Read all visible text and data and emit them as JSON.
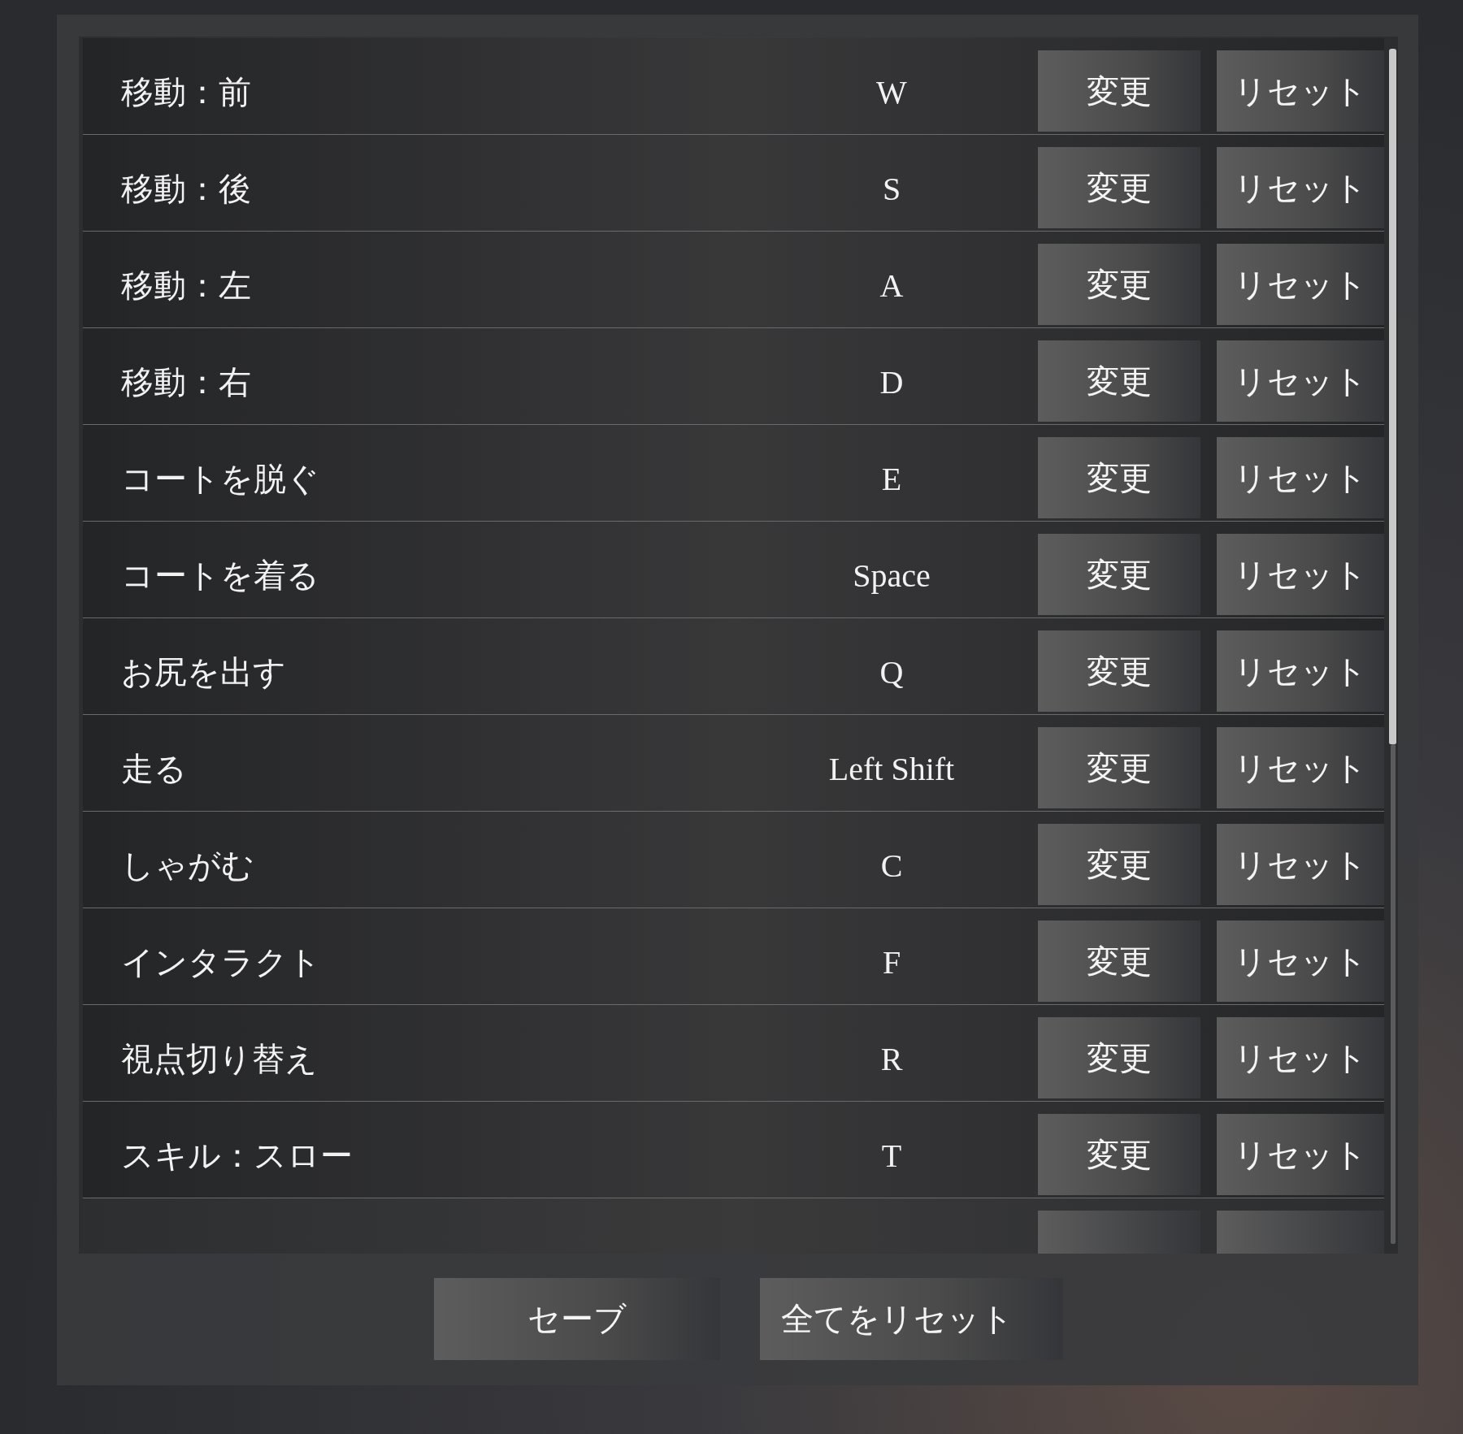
{
  "bindings": [
    {
      "action": "移動：前",
      "key": "W",
      "change": "変更",
      "reset": "リセット"
    },
    {
      "action": "移動：後",
      "key": "S",
      "change": "変更",
      "reset": "リセット"
    },
    {
      "action": "移動：左",
      "key": "A",
      "change": "変更",
      "reset": "リセット"
    },
    {
      "action": "移動：右",
      "key": "D",
      "change": "変更",
      "reset": "リセット"
    },
    {
      "action": "コートを脱ぐ",
      "key": "E",
      "change": "変更",
      "reset": "リセット"
    },
    {
      "action": "コートを着る",
      "key": "Space",
      "change": "変更",
      "reset": "リセット"
    },
    {
      "action": "お尻を出す",
      "key": "Q",
      "change": "変更",
      "reset": "リセット"
    },
    {
      "action": "走る",
      "key": "Left Shift",
      "change": "変更",
      "reset": "リセット"
    },
    {
      "action": "しゃがむ",
      "key": "C",
      "change": "変更",
      "reset": "リセット"
    },
    {
      "action": "インタラクト",
      "key": "F",
      "change": "変更",
      "reset": "リセット"
    },
    {
      "action": "視点切り替え",
      "key": "R",
      "change": "変更",
      "reset": "リセット"
    },
    {
      "action": "スキル：スロー",
      "key": "T",
      "change": "変更",
      "reset": "リセット"
    }
  ],
  "footer_buttons": [
    "セーブ",
    "全てをリセット"
  ]
}
